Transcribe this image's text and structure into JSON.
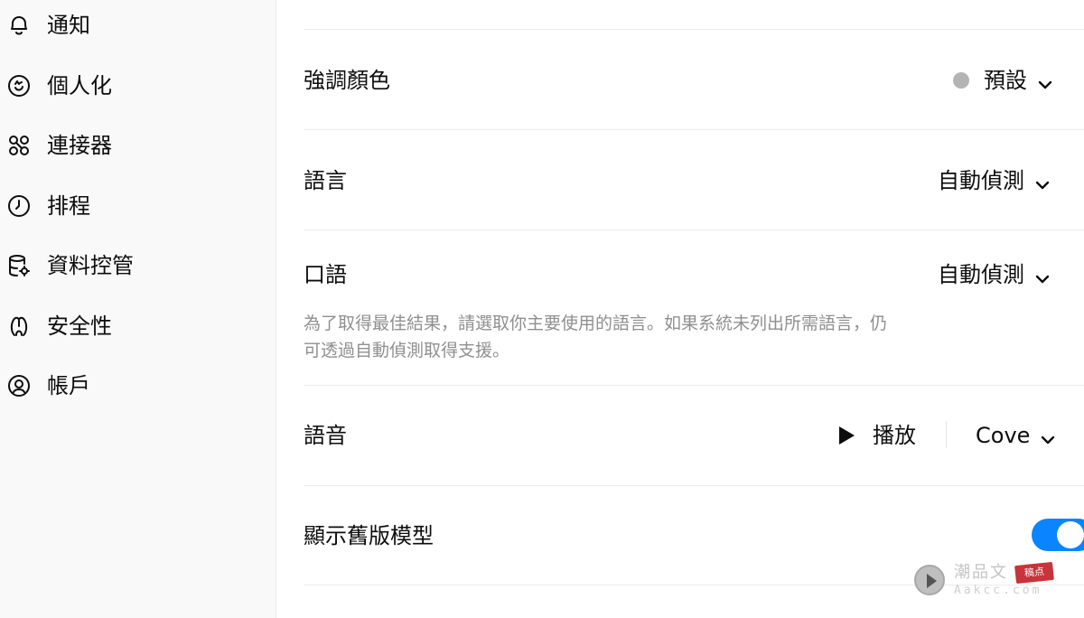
{
  "sidebar": {
    "items": [
      {
        "label": "通知",
        "icon": "bell-icon"
      },
      {
        "label": "個人化",
        "icon": "personalization-icon"
      },
      {
        "label": "連接器",
        "icon": "connectors-icon"
      },
      {
        "label": "排程",
        "icon": "clock-icon"
      },
      {
        "label": "資料控管",
        "icon": "database-gear-icon"
      },
      {
        "label": "安全性",
        "icon": "security-icon"
      },
      {
        "label": "帳戶",
        "icon": "account-icon"
      }
    ]
  },
  "settings": {
    "accent_color": {
      "label": "強調顏色",
      "value": "預設",
      "swatch_color": "#b4b4b4"
    },
    "language": {
      "label": "語言",
      "value": "自動偵測"
    },
    "spoken_language": {
      "label": "口語",
      "value": "自動偵測",
      "description_line1": "為了取得最佳結果，請選取你主要使用的語言。如果系統未列出所需語言，仍",
      "description_line2": "可透過自動偵測取得支援。"
    },
    "voice": {
      "label": "語音",
      "play_label": "播放",
      "value": "Cove"
    },
    "legacy_models": {
      "label": "顯示舊版模型",
      "enabled": true,
      "toggle_color": "#0a84ff"
    }
  },
  "watermark": {
    "text": "潮品文",
    "stamp": "稿点",
    "sub": "Aakcc.com"
  }
}
